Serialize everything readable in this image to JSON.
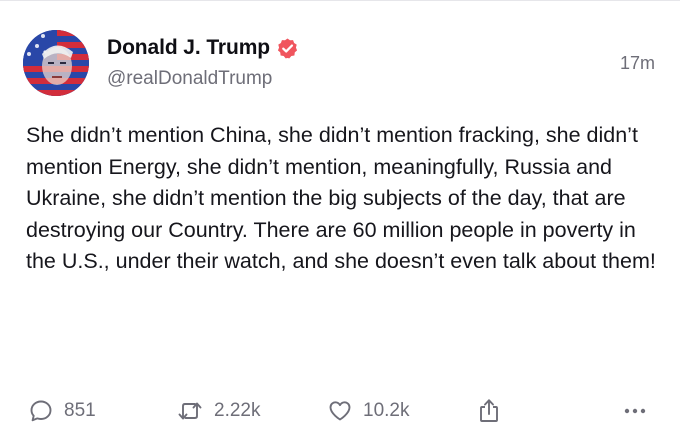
{
  "post": {
    "author": {
      "display_name": "Donald J. Trump",
      "handle": "@realDonaldTrump",
      "verified": true,
      "verified_color": "#f0555e"
    },
    "timestamp": "17m",
    "text": "She didn’t mention China, she didn’t mention fracking, she didn’t mention Energy, she didn’t mention, meaningfully, Russia and Ukraine, she didn’t mention the big subjects of the day, that are destroying our Country. There are 60 million people in poverty in the U.S., under their watch, and she doesn’t even talk about them!",
    "actions": {
      "reply": {
        "icon": "comment-icon",
        "count": "851"
      },
      "repost": {
        "icon": "repost-icon",
        "count": "2.22k"
      },
      "like": {
        "icon": "heart-icon",
        "count": "10.2k"
      },
      "share": {
        "icon": "share-icon"
      },
      "more": {
        "icon": "more-icon"
      }
    }
  },
  "colors": {
    "text": "#16161c",
    "muted": "#6e6e78",
    "background": "#ffffff"
  }
}
